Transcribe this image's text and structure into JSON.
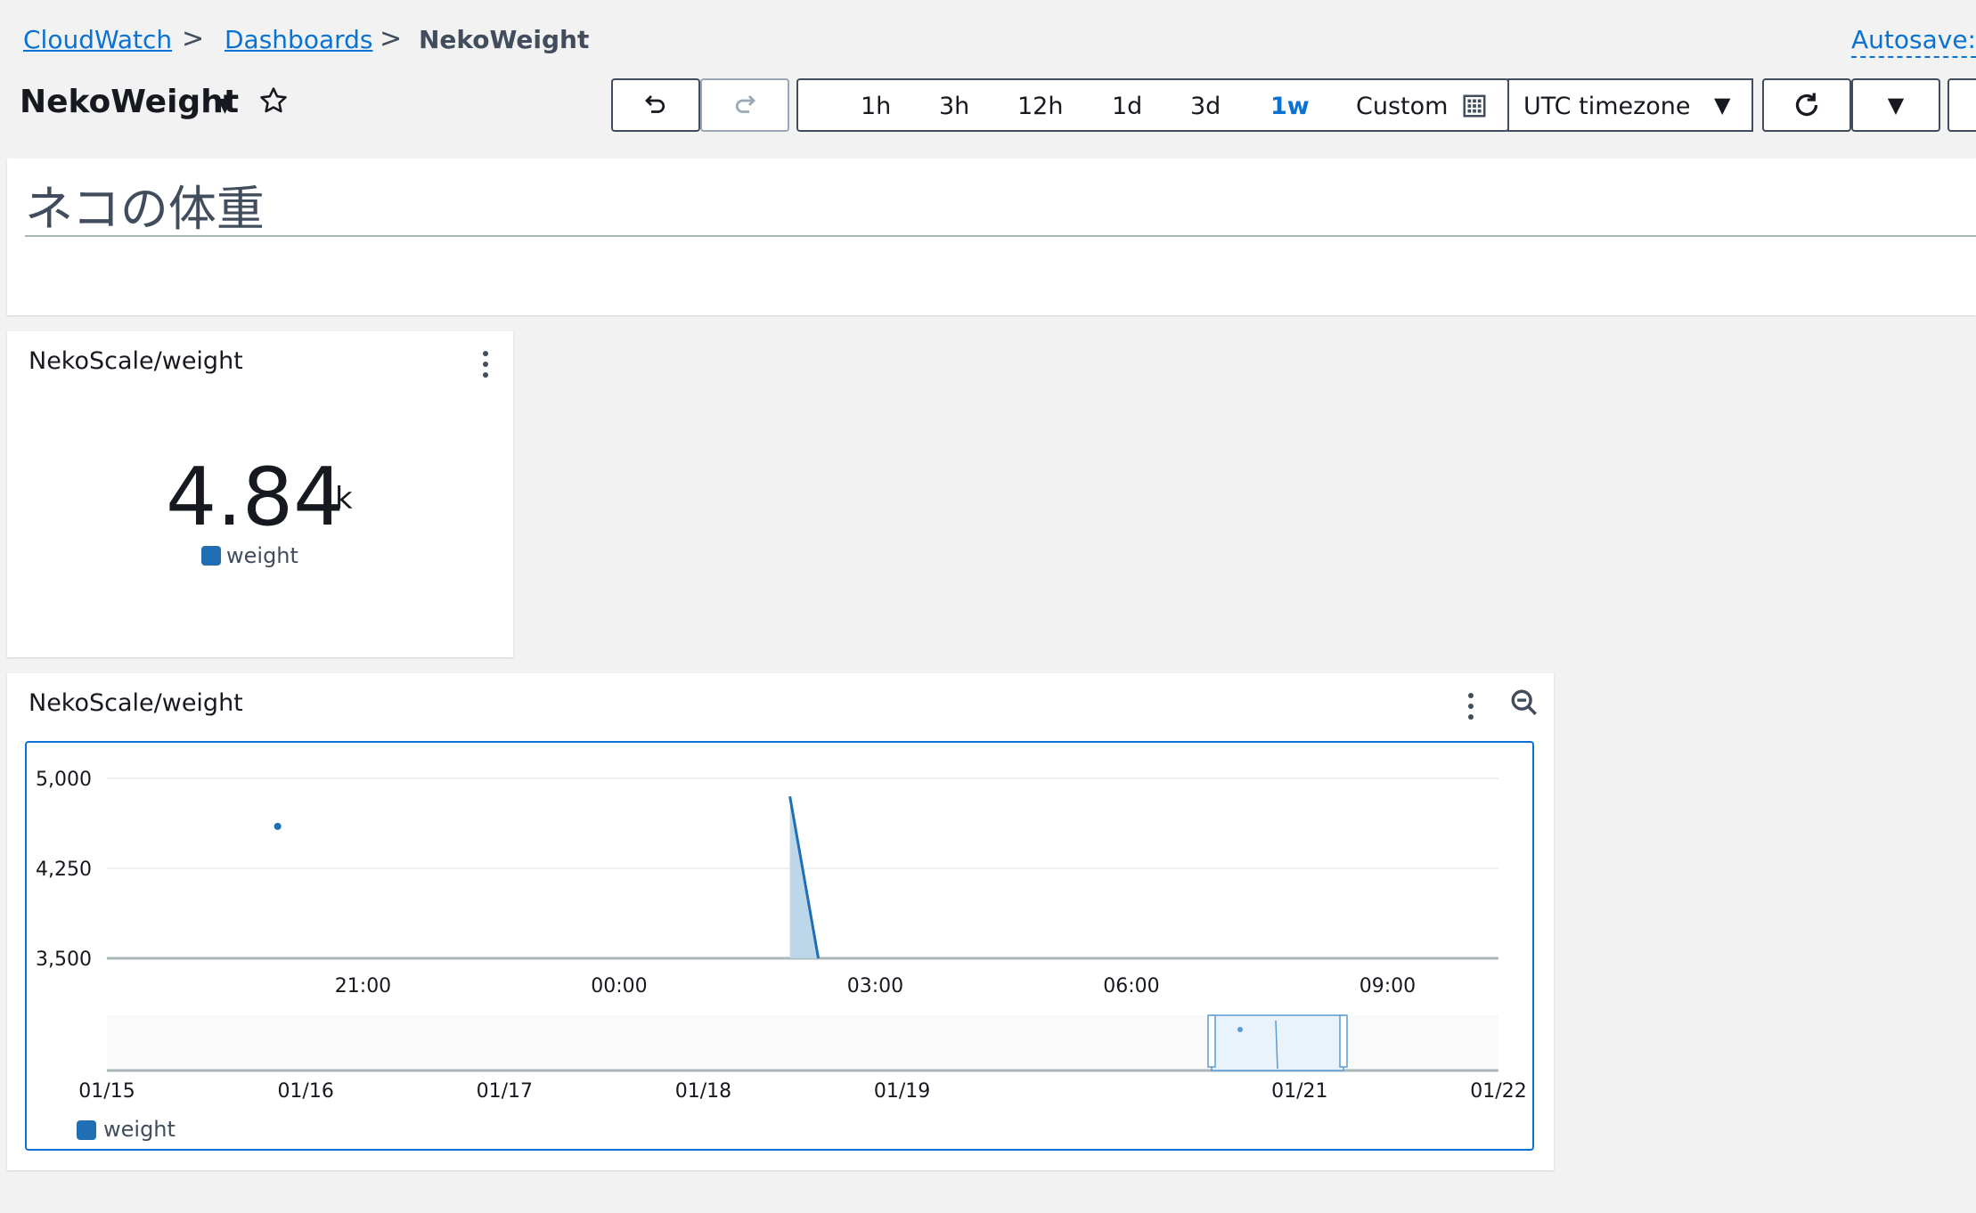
{
  "breadcrumb": {
    "items": [
      "CloudWatch",
      "Dashboards"
    ],
    "current": "NekoWeight",
    "separator": ">"
  },
  "autosave_label": "Autosave:",
  "dashboard": {
    "title": "NekoWeight"
  },
  "time_range": {
    "options": [
      "1h",
      "3h",
      "12h",
      "1d",
      "3d",
      "1w"
    ],
    "active": "1w",
    "custom_label": "Custom"
  },
  "timezone": {
    "label": "UTC timezone"
  },
  "text_widget": {
    "title": "ネコの体重"
  },
  "number_widget": {
    "title": "NekoScale/weight",
    "value": "4.84",
    "unit": "k",
    "legend": "weight"
  },
  "line_widget": {
    "title": "NekoScale/weight",
    "legend": "weight"
  },
  "colors": {
    "accent": "#0972d3",
    "series": "#1f6fb2",
    "series_fill": "#bcd6ea"
  },
  "icons": [
    "undo-icon",
    "redo-icon",
    "calendar-icon",
    "refresh-icon",
    "caret-down-icon",
    "star-icon",
    "kebab-menu-icon",
    "zoom-out-icon"
  ],
  "chart_data": {
    "type": "line",
    "series": [
      {
        "name": "weight",
        "points": [
          {
            "x": "20:00",
            "y": 4600
          },
          {
            "x": "02:00",
            "y": 4850
          },
          {
            "x": "02:20",
            "y": 3500
          }
        ]
      }
    ],
    "y_ticks": [
      "5,000",
      "4,250",
      "3,500"
    ],
    "ylim": [
      3500,
      5000
    ],
    "x_ticks": [
      "21:00",
      "00:00",
      "03:00",
      "06:00",
      "09:00"
    ],
    "overview_x_ticks": [
      "01/15",
      "01/16",
      "01/17",
      "01/18",
      "01/19",
      "01/21",
      "01/22"
    ],
    "grid": true,
    "legend_position": "bottom-left"
  }
}
